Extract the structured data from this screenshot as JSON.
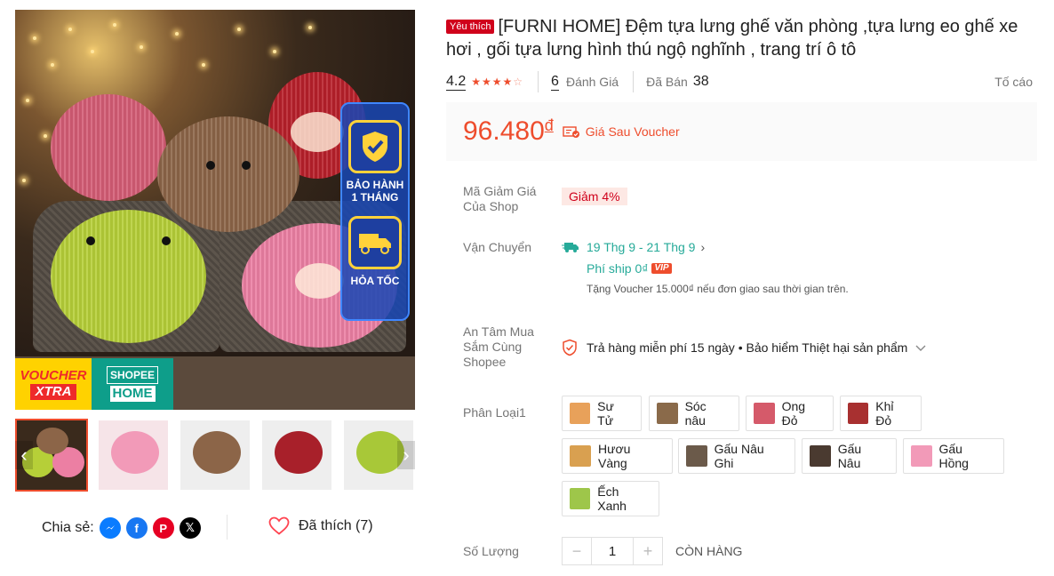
{
  "gallery": {
    "badges": [
      {
        "icon": "shield-check-icon",
        "label": "BẢO HÀNH 1 THÁNG"
      },
      {
        "icon": "delivery-truck-icon",
        "label": "HỎA TỐC"
      }
    ],
    "voucher_xtra": {
      "line1": "VOUCHER",
      "line2": "XTRA"
    },
    "shopee_home": {
      "line1": "SHOPEE",
      "line2": "HOME"
    },
    "thumbnails": [
      "frog-bear-set",
      "pink-bear",
      "brown-dog",
      "red-monkey",
      "green-frog"
    ]
  },
  "share": {
    "label": "Chia sẻ:",
    "networks": [
      "messenger-icon",
      "facebook-icon",
      "pinterest-icon",
      "x-twitter-icon"
    ]
  },
  "like": {
    "label": "Đã thích (7)"
  },
  "product": {
    "favorite_badge": "Yêu thích",
    "title": "[FURNI HOME] Đệm tựa lưng ghế văn phòng ,tựa lưng eo ghế xe hơi , gối tựa lưng hình thú ngộ nghĩnh , trang trí ô tô",
    "rating": "4.2",
    "stars": 4,
    "review_count": "6",
    "review_label": "Đánh Giá",
    "sold_label": "Đã Bán",
    "sold_count": "38",
    "report_label": "Tố cáo"
  },
  "price": {
    "amount": "96.480",
    "currency": "đ",
    "note": "Giá Sau Voucher"
  },
  "shop_voucher": {
    "label": "Mã Giảm Giá Của Shop",
    "value": "Giảm 4%"
  },
  "shipping": {
    "label": "Vận Chuyển",
    "date": "19 Thg 9 - 21 Thg 9",
    "fee": "Phí ship 0₫",
    "vip": "VIP",
    "voucher_note": "Tặng Voucher 15.000₫ nếu đơn giao sau thời gian trên."
  },
  "assurance": {
    "label": "An Tâm Mua Sắm Cùng Shopee",
    "text": "Trả hàng miễn phí 15 ngày • Bảo hiểm Thiệt hại sản phẩm"
  },
  "variants": {
    "label": "Phân Loại1",
    "options": [
      {
        "name": "Sư Tử",
        "color": "#e8a15a"
      },
      {
        "name": "Sóc nâu",
        "color": "#8a6a4a"
      },
      {
        "name": "Ong Đỏ",
        "color": "#d55a6a"
      },
      {
        "name": "Khỉ Đỏ",
        "color": "#a83030"
      },
      {
        "name": "Hươu Vàng",
        "color": "#d9a050"
      },
      {
        "name": "Gấu Nâu Ghi",
        "color": "#6b5a4a"
      },
      {
        "name": "Gấu Nâu",
        "color": "#4a3a30"
      },
      {
        "name": "Gấu Hồng",
        "color": "#f29ab8"
      },
      {
        "name": "Ếch Xanh",
        "color": "#9ec64a"
      }
    ]
  },
  "quantity": {
    "label": "Số Lượng",
    "value": "1",
    "minus": "−",
    "plus": "+",
    "stock": "CÒN HÀNG"
  },
  "colors": {
    "accent": "#ee4d2d",
    "teal": "#26aa99"
  }
}
